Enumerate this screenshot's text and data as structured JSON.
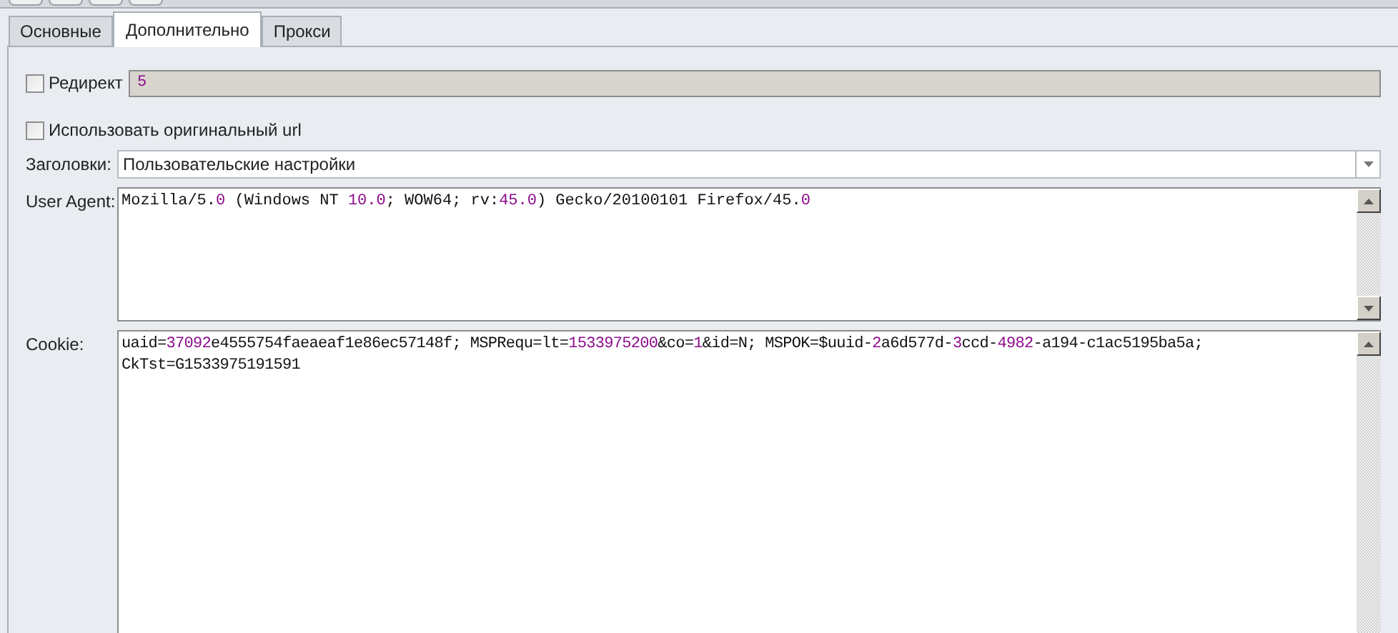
{
  "tabs": [
    {
      "label": "Основные",
      "selected": false
    },
    {
      "label": "Дополнительно",
      "selected": true
    },
    {
      "label": "Прокси",
      "selected": false
    }
  ],
  "redirect": {
    "label": "Редирект",
    "checked": false,
    "value": [
      {
        "text": "5",
        "kind": "number"
      }
    ],
    "disabled": true
  },
  "use_original_url": {
    "label": "Использовать оригинальный url",
    "checked": false
  },
  "headers": {
    "label": "Заголовки:",
    "value": "Пользовательские настройки"
  },
  "user_agent": {
    "label": "User Agent:",
    "lines": [
      [
        {
          "text": "Mozilla/5.",
          "kind": "plain"
        },
        {
          "text": "0",
          "kind": "number"
        },
        {
          "text": " (Windows NT ",
          "kind": "plain"
        },
        {
          "text": "10.0",
          "kind": "number"
        },
        {
          "text": "; WOW64; rv:",
          "kind": "plain"
        },
        {
          "text": "45.0",
          "kind": "number"
        },
        {
          "text": ") Gecko/20100101 Firefox/45.",
          "kind": "plain"
        },
        {
          "text": "0",
          "kind": "number"
        }
      ]
    ]
  },
  "cookie": {
    "label": "Cookie:",
    "lines": [
      [
        {
          "text": "uaid=",
          "kind": "plain"
        },
        {
          "text": "37092",
          "kind": "number"
        },
        {
          "text": "e4555754faeaeaf1e86ec57148f; MSPRequ=lt=",
          "kind": "plain"
        },
        {
          "text": "1533975200",
          "kind": "number"
        },
        {
          "text": "&co=",
          "kind": "plain"
        },
        {
          "text": "1",
          "kind": "number"
        },
        {
          "text": "&id=N; MSPOK=$uuid-",
          "kind": "plain"
        },
        {
          "text": "2",
          "kind": "number"
        },
        {
          "text": "a6d577d-",
          "kind": "plain"
        },
        {
          "text": "3",
          "kind": "number"
        },
        {
          "text": "ccd-",
          "kind": "plain"
        },
        {
          "text": "4982",
          "kind": "number"
        },
        {
          "text": "-a194-c1ac5195ba5a;",
          "kind": "plain"
        }
      ],
      [
        {
          "text": "CkTst=G1533975191591",
          "kind": "plain"
        }
      ]
    ]
  }
}
